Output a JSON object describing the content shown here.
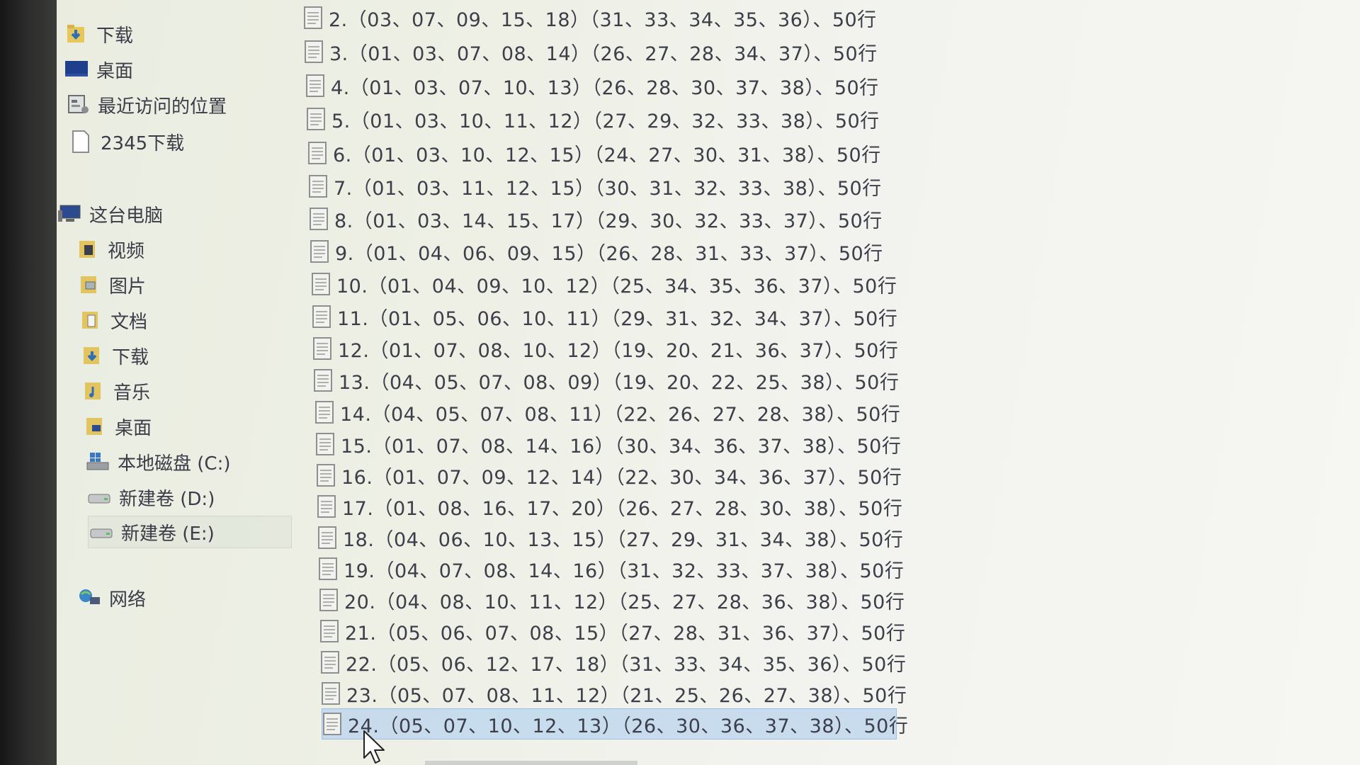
{
  "nav": {
    "quick_access": [
      {
        "label": "下载",
        "icon": "download-folder-icon"
      },
      {
        "label": "桌面",
        "icon": "desktop-icon"
      },
      {
        "label": "最近访问的位置",
        "icon": "recent-places-icon"
      },
      {
        "label": "2345下载",
        "icon": "folder-icon"
      }
    ],
    "this_pc": {
      "label": "这台电脑",
      "icon": "computer-icon",
      "items": [
        {
          "label": "视频",
          "icon": "videos-folder-icon"
        },
        {
          "label": "图片",
          "icon": "pictures-folder-icon"
        },
        {
          "label": "文档",
          "icon": "documents-folder-icon"
        },
        {
          "label": "下载",
          "icon": "download-folder-icon"
        },
        {
          "label": "音乐",
          "icon": "music-folder-icon"
        },
        {
          "label": "桌面",
          "icon": "desktop-folder-icon"
        },
        {
          "label": "本地磁盘 (C:)",
          "icon": "system-drive-icon"
        },
        {
          "label": "新建卷 (D:)",
          "icon": "drive-icon"
        },
        {
          "label": "新建卷 (E:)",
          "icon": "drive-icon",
          "selected": true
        }
      ]
    },
    "network": {
      "label": "网络",
      "icon": "network-icon"
    }
  },
  "files": [
    {
      "name": "2.（03、07、09、15、18）（31、33、34、35、36）、50行"
    },
    {
      "name": "3.（01、03、07、08、14）（26、27、28、34、37）、50行"
    },
    {
      "name": "4.（01、03、07、10、13）（26、28、30、37、38）、50行"
    },
    {
      "name": "5.（01、03、10、11、12）（27、29、32、33、38）、50行"
    },
    {
      "name": "6.（01、03、10、12、15）（24、27、30、31、38）、50行"
    },
    {
      "name": "7.（01、03、11、12、15）（30、31、32、33、38）、50行"
    },
    {
      "name": "8.（01、03、14、15、17）（29、30、32、33、37）、50行"
    },
    {
      "name": "9.（01、04、06、09、15）（26、28、31、33、37）、50行"
    },
    {
      "name": "10.（01、04、09、10、12）（25、34、35、36、37）、50行"
    },
    {
      "name": "11.（01、05、06、10、11）（29、31、32、34、37）、50行"
    },
    {
      "name": "12.（01、07、08、10、12）（19、20、21、36、37）、50行"
    },
    {
      "name": "13.（04、05、07、08、09）（19、20、22、25、38）、50行"
    },
    {
      "name": "14.（04、05、07、08、11）（22、26、27、28、38）、50行"
    },
    {
      "name": "15.（01、07、08、14、16）（30、34、36、37、38）、50行"
    },
    {
      "name": "16.（01、07、09、12、14）（22、30、34、36、37）、50行"
    },
    {
      "name": "17.（01、08、16、17、20）（26、27、28、30、38）、50行"
    },
    {
      "name": "18.（04、06、10、13、15）（27、29、31、34、38）、50行"
    },
    {
      "name": "19.（04、07、08、14、16）（31、32、33、37、38）、50行"
    },
    {
      "name": "20.（04、08、10、11、12）（25、27、28、36、38）、50行"
    },
    {
      "name": "21.（05、06、07、08、15）（27、28、31、36、37）、50行"
    },
    {
      "name": "22.（05、06、12、17、18）（31、33、34、35、36）、50行"
    },
    {
      "name": "23.（05、07、08、11、12）（21、25、26、27、38）、50行"
    },
    {
      "name": "24.（05、07、10、12、13）（26、30、36、37、38）、50行",
      "selected": true
    }
  ],
  "colors": {
    "selection_fill": "#bad4ee",
    "selection_border": "#9fc0e6",
    "text": "#3c3f49"
  }
}
